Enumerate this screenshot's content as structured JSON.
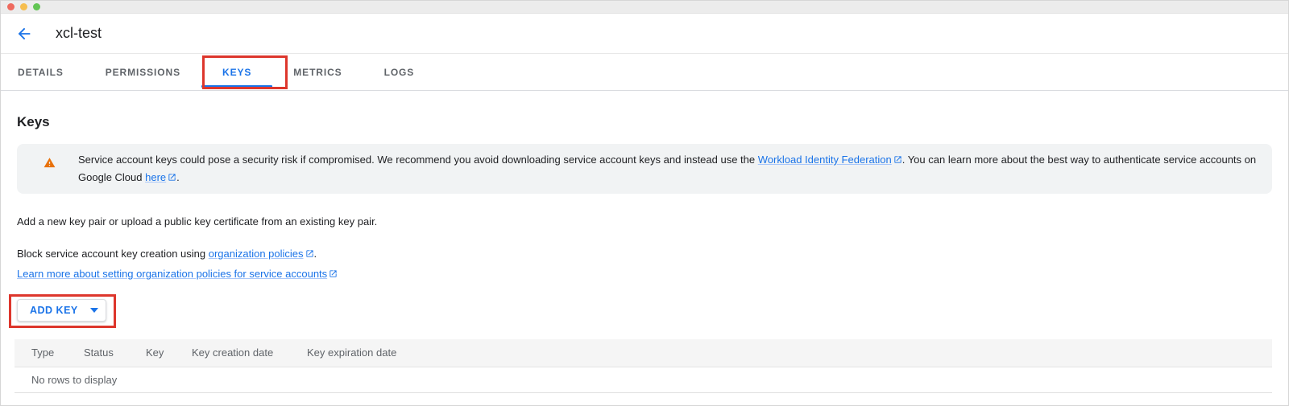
{
  "window": {
    "title": "xcl-test",
    "controls": [
      "close",
      "minimize",
      "zoom"
    ]
  },
  "tabs": [
    {
      "label": "DETAILS",
      "active": false
    },
    {
      "label": "PERMISSIONS",
      "active": false
    },
    {
      "label": "KEYS",
      "active": true,
      "annotated": true
    },
    {
      "label": "METRICS",
      "active": false
    },
    {
      "label": "LOGS",
      "active": false
    }
  ],
  "page": {
    "heading": "Keys"
  },
  "warning_banner": {
    "text_before_link1": "Service account keys could pose a security risk if compromised. We recommend you avoid downloading service account keys and instead use the ",
    "link1": "Workload Identity Federation",
    "text_middle": ". You can learn more about the best way to authenticate service accounts on Google Cloud ",
    "link2": "here",
    "text_after": "."
  },
  "body_text": {
    "add_text": "Add a new key pair or upload a public key certificate from an existing key pair.",
    "block_before": "Block service account key creation using ",
    "block_link": "organization policies",
    "block_after": ".",
    "learn_link": "Learn more about setting organization policies for service accounts"
  },
  "add_key_button": {
    "label": "ADD KEY"
  },
  "table": {
    "headers": [
      "Type",
      "Status",
      "Key",
      "Key creation date",
      "Key expiration date"
    ],
    "empty_text": "No rows to display",
    "rows": []
  },
  "icons": {
    "back": "arrow-back",
    "warning": "warning-triangle",
    "external_link": "open-in-new",
    "button_caret": "arrow-drop-down"
  },
  "colors": {
    "accent_blue": "#1a73e8",
    "annotation_red": "#dd362c",
    "warning_orange": "#e8710a",
    "banner_bg": "#f1f3f4",
    "tab_inactive": "#5f6368"
  }
}
